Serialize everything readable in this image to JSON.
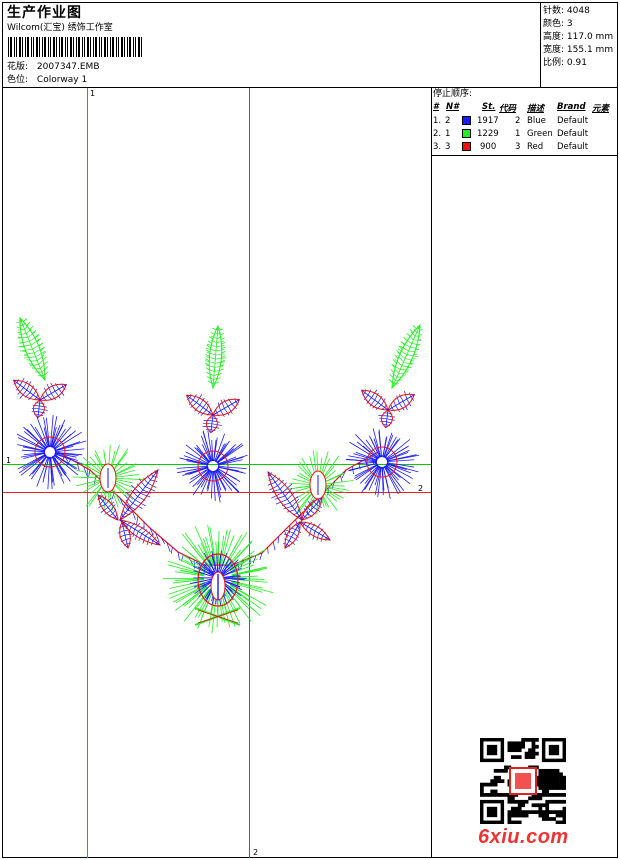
{
  "header": {
    "title": "生产作业图",
    "company": "Wilcom(汇宝) 绣饰工作室",
    "design_label": "花版:",
    "design_value": "2007347.EMB",
    "colorway_label": "色位:",
    "colorway_value": "Colorway 1"
  },
  "stats": {
    "stitches_label": "针数:",
    "stitches_value": "4048",
    "colors_label": "颜色:",
    "colors_value": "3",
    "height_label": "高度:",
    "height_value": "117.0 mm",
    "width_label": "宽度:",
    "width_value": "155.1 mm",
    "scale_label": "比例:",
    "scale_value": "0.91"
  },
  "threads": {
    "section_title": "停止顺序:",
    "columns": [
      "#",
      "N#",
      "St.",
      "代码",
      "描述",
      "Brand",
      "元素"
    ],
    "rows": [
      {
        "seq": "1.",
        "n": "2",
        "color": "#1a1aff",
        "stitches": "1917",
        "code": "2",
        "desc": "Blue",
        "brand": "Default"
      },
      {
        "seq": "2.",
        "n": "1",
        "color": "#22ee22",
        "stitches": "1229",
        "code": "1",
        "desc": "Green",
        "brand": "Default"
      },
      {
        "seq": "3.",
        "n": "3",
        "color": "#ee1111",
        "stitches": "900",
        "code": "3",
        "desc": "Red",
        "brand": "Default"
      }
    ]
  },
  "guides": {
    "v1_label": "1",
    "v2_label": "2",
    "h1_label": "1",
    "h2_label": "2"
  },
  "watermark": {
    "site": "6xiu.com"
  },
  "colors": {
    "blue": "#1a1aff",
    "green": "#22ee22",
    "red": "#ee1111",
    "guide_green": "#00cc00",
    "guide_red": "#ee2222"
  }
}
